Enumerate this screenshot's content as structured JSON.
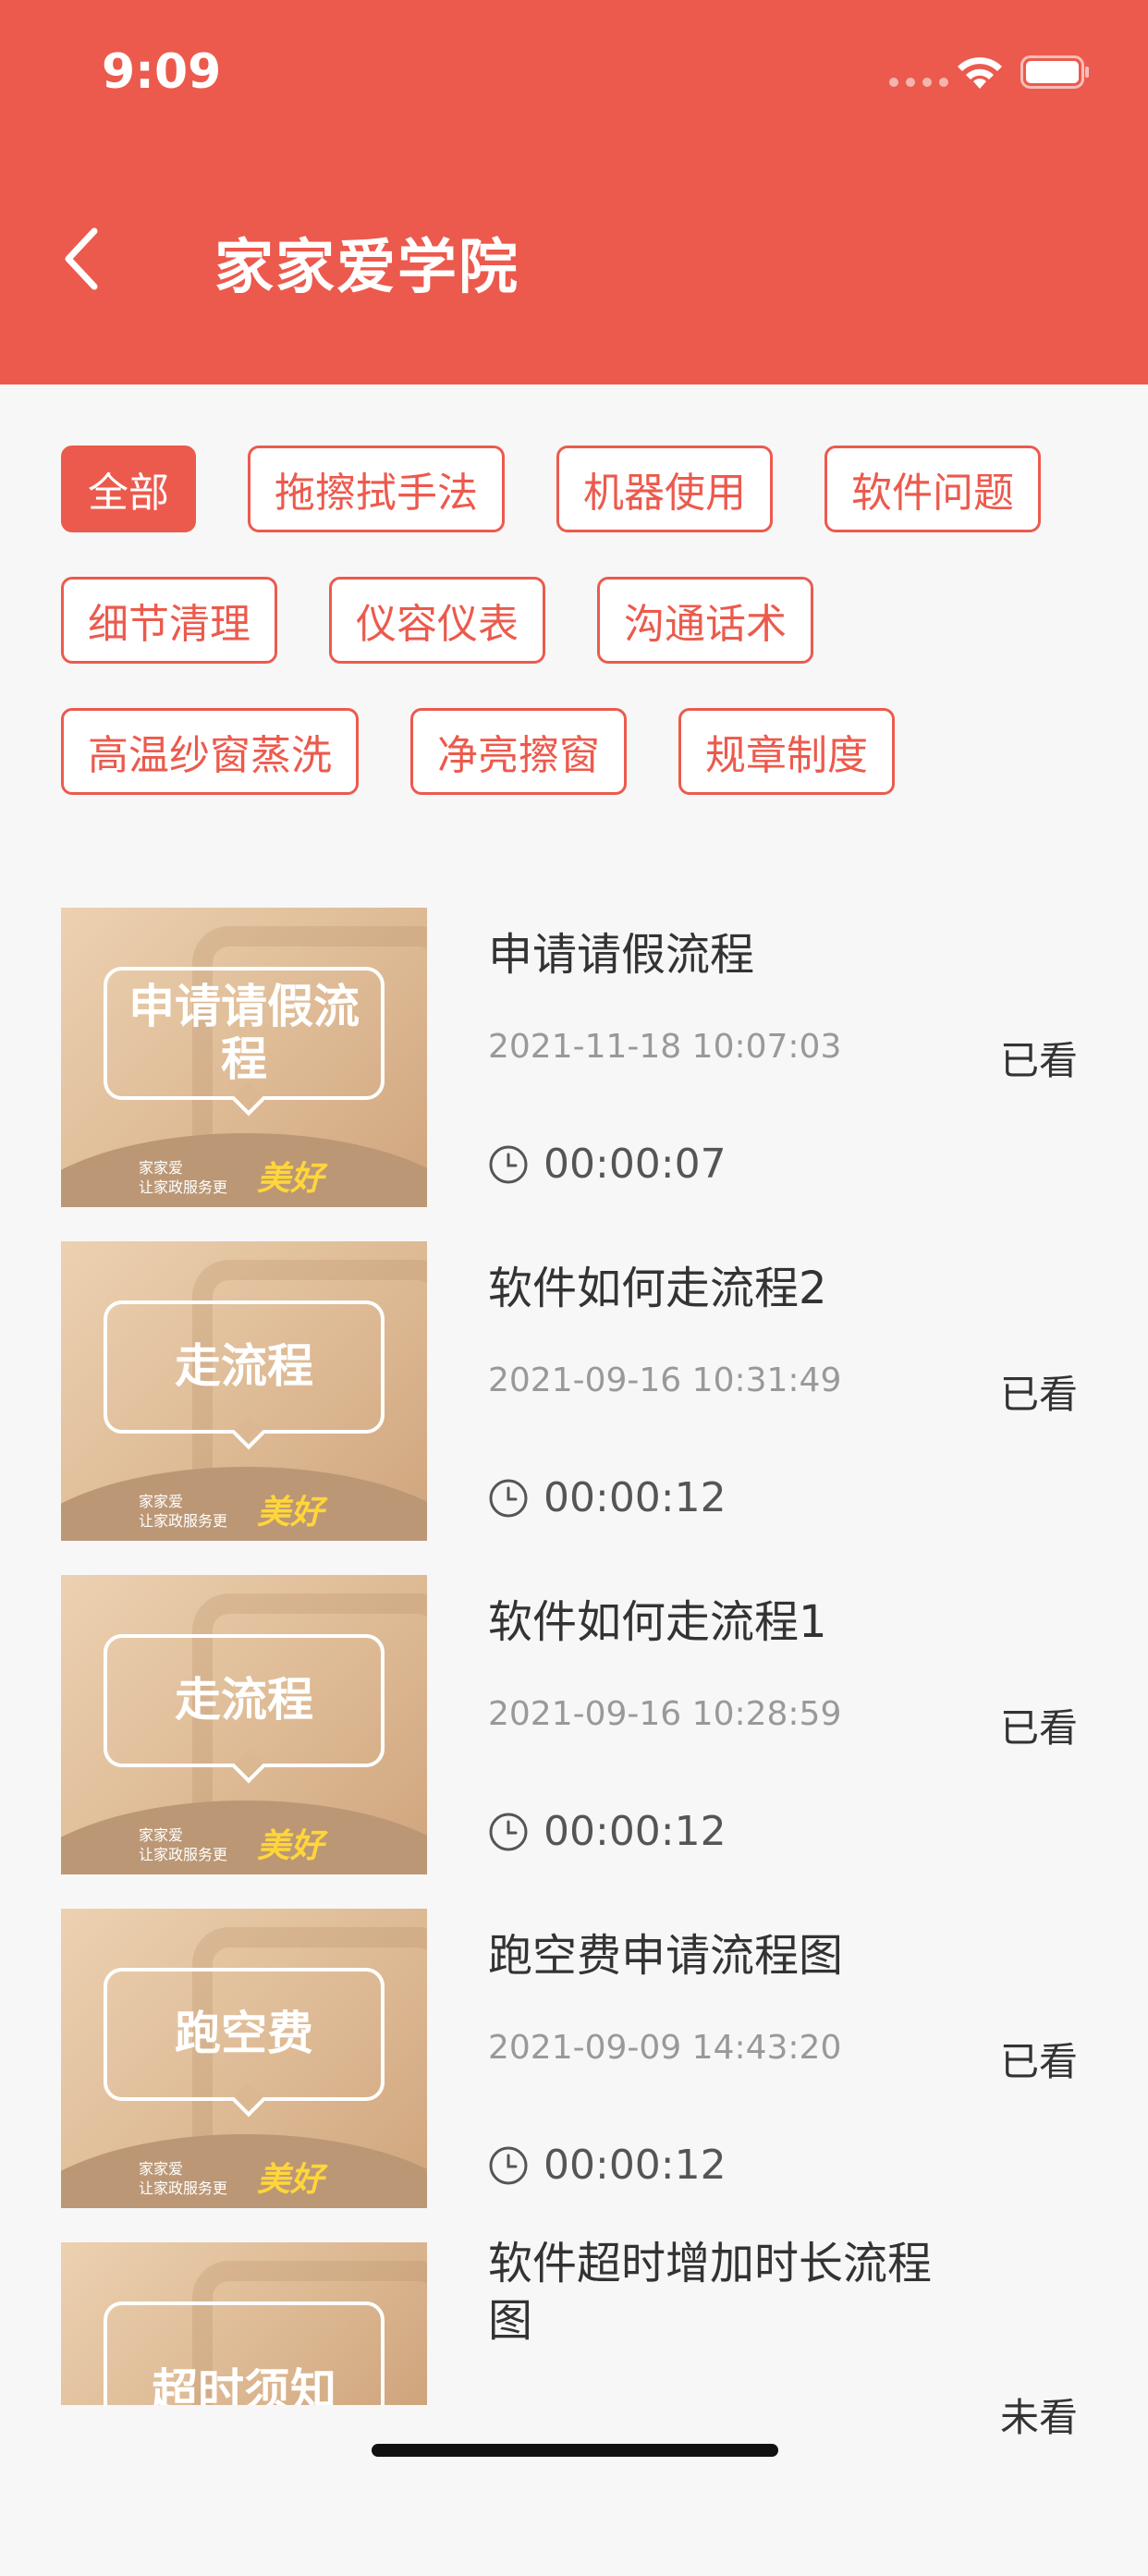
{
  "status_bar": {
    "time": "9:09"
  },
  "header": {
    "title": "家家爱学院"
  },
  "tags": [
    {
      "label": "全部",
      "active": true
    },
    {
      "label": "拖擦拭手法",
      "active": false
    },
    {
      "label": "机器使用",
      "active": false
    },
    {
      "label": "软件问题",
      "active": false
    },
    {
      "label": "细节清理",
      "active": false
    },
    {
      "label": "仪容仪表",
      "active": false
    },
    {
      "label": "沟通话术",
      "active": false
    },
    {
      "label": "高温纱窗蒸洗",
      "active": false
    },
    {
      "label": "净亮擦窗",
      "active": false
    },
    {
      "label": "规章制度",
      "active": false
    }
  ],
  "brand": {
    "sub_line1": "家家爱",
    "sub_line2": "让家政服务更",
    "mark": "美好"
  },
  "videos": [
    {
      "thumb_text": "申请请假流程",
      "title": "申请请假流程",
      "date": "2021-11-18 10:07:03",
      "status": "已看",
      "duration": "00:00:07"
    },
    {
      "thumb_text": "走流程",
      "title": "软件如何走流程2",
      "date": "2021-09-16 10:31:49",
      "status": "已看",
      "duration": "00:00:12"
    },
    {
      "thumb_text": "走流程",
      "title": "软件如何走流程1",
      "date": "2021-09-16 10:28:59",
      "status": "已看",
      "duration": "00:00:12"
    },
    {
      "thumb_text": "跑空费",
      "title": "跑空费申请流程图",
      "date": "2021-09-09 14:43:20",
      "status": "已看",
      "duration": "00:00:12"
    },
    {
      "thumb_text": "超时须知",
      "title": "软件超时增加时长流程图",
      "status": "未看"
    }
  ],
  "colors": {
    "accent": "#ec5a4d",
    "background": "#f7f7f7",
    "thumbnail_tan": "#dcb892"
  }
}
